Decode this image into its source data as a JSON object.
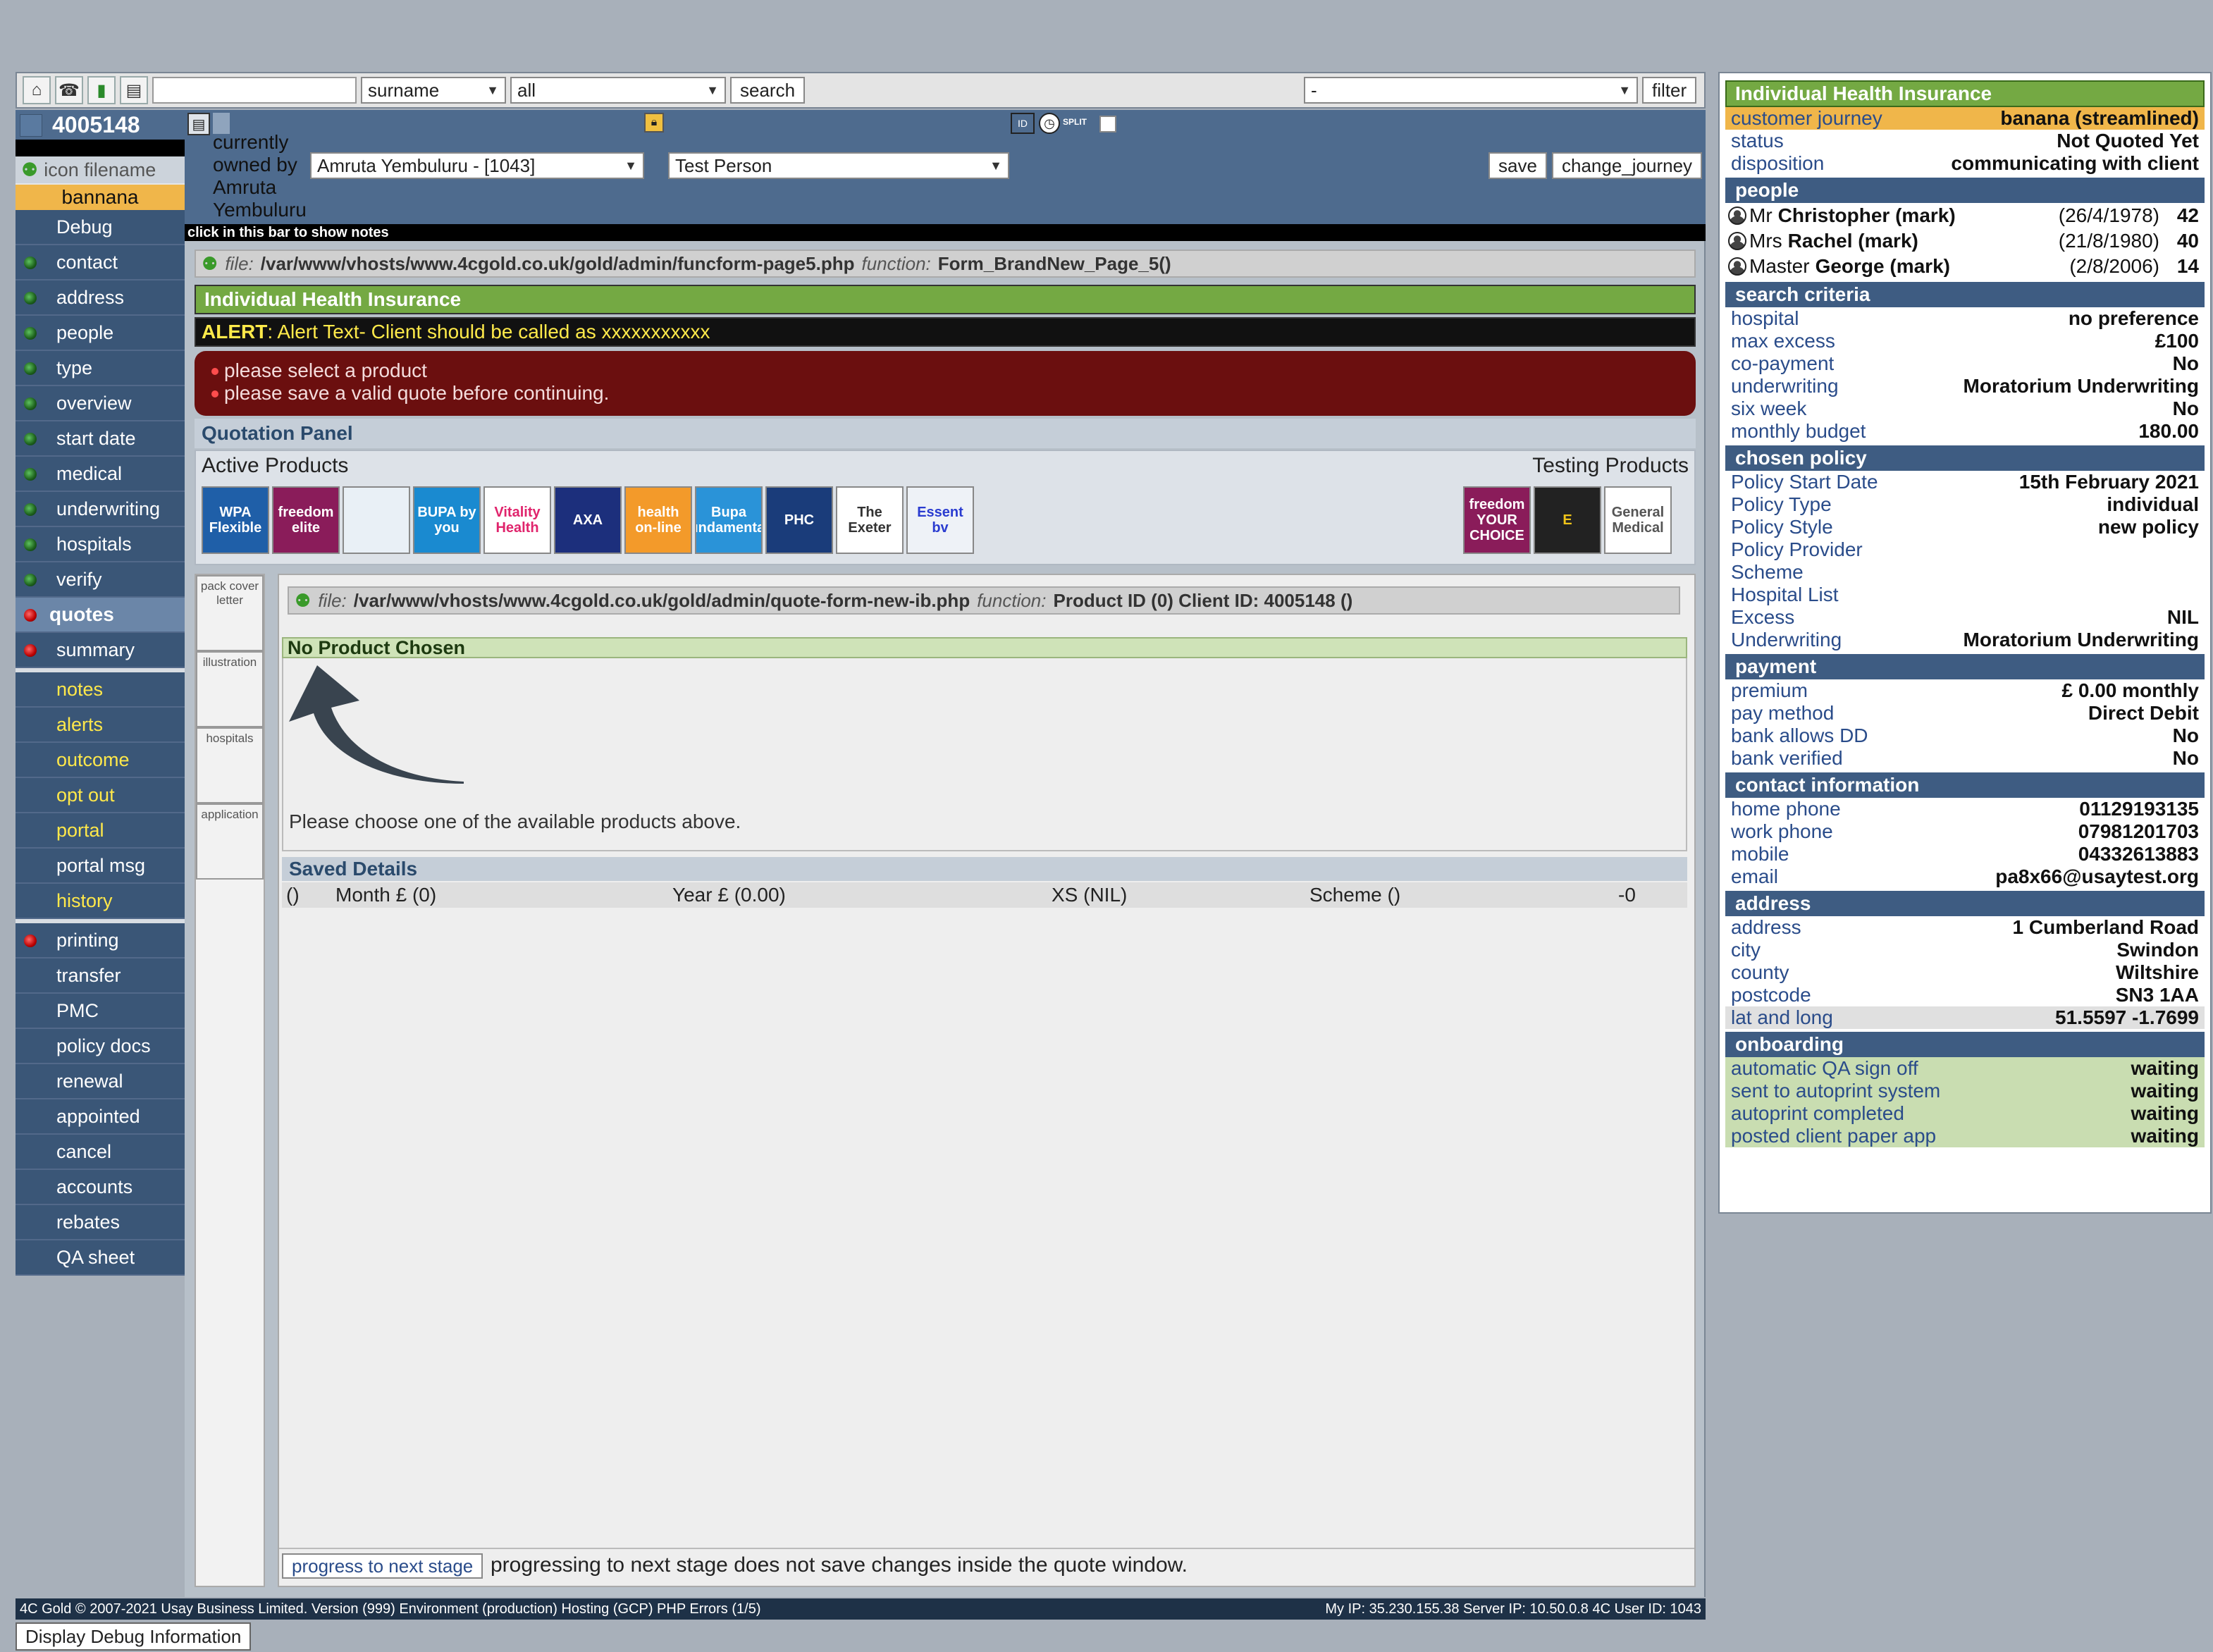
{
  "topbar": {
    "search_value": "",
    "field_select": "surname",
    "scope_select": "all",
    "search_label": "search",
    "filter_select": "-",
    "filter_label": "filter"
  },
  "sidebar": {
    "client_id": "4005148",
    "icon_filename": "icon filename",
    "journey": "bannana",
    "items": [
      {
        "label": "Debug"
      },
      {
        "label": "contact"
      },
      {
        "label": "address"
      },
      {
        "label": "people"
      },
      {
        "label": "type"
      },
      {
        "label": "overview"
      },
      {
        "label": "start date"
      },
      {
        "label": "medical"
      },
      {
        "label": "underwriting"
      },
      {
        "label": "hospitals"
      },
      {
        "label": "verify"
      },
      {
        "label": "quotes"
      },
      {
        "label": "summary"
      },
      {
        "label": "notes"
      },
      {
        "label": "alerts"
      },
      {
        "label": "outcome"
      },
      {
        "label": "opt out"
      },
      {
        "label": "portal"
      },
      {
        "label": "portal msg"
      },
      {
        "label": "history"
      },
      {
        "label": "printing"
      },
      {
        "label": "transfer"
      },
      {
        "label": "PMC"
      },
      {
        "label": "policy docs"
      },
      {
        "label": "renewal"
      },
      {
        "label": "appointed"
      },
      {
        "label": "cancel"
      },
      {
        "label": "accounts"
      },
      {
        "label": "rebates"
      },
      {
        "label": "QA sheet"
      }
    ]
  },
  "header": {
    "owned_by_text": "currently owned by Amruta Yembuluru",
    "owner_select": "Amruta Yembuluru - [1043]",
    "person_select": "Test Person",
    "save_label": "save",
    "change_journey_label": "change_journey",
    "split_label": "SPLIT",
    "id_label": "ID",
    "notes_bar": "click in this bar to show notes"
  },
  "main": {
    "file1": {
      "prefix": "file:",
      "path": "/var/www/vhosts/www.4cgold.co.uk/gold/admin/funcform-page5.php",
      "fn_label": "function:",
      "fn": "Form_BrandNew_Page_5()"
    },
    "product_title": "Individual Health Insurance",
    "alert_label": "ALERT",
    "alert_text": ": Alert Text- Client should be called as xxxxxxxxxxx",
    "errors": [
      "please select a product",
      "please save a valid quote before continuing."
    ],
    "quotation_panel": "Quotation Panel",
    "active_products": "Active Products",
    "testing_products": "Testing Products",
    "active_logos": [
      {
        "name": "wpa-flexible-logo",
        "text": "WPA Flexible",
        "bg": "#1f5fa8",
        "fg": "#ffffff"
      },
      {
        "name": "freedom-elite-logo",
        "text": "freedom elite",
        "bg": "#8a1c5a",
        "fg": "#ffffff"
      },
      {
        "name": "aviva-logo",
        "text": "",
        "bg": "#e9f0f6",
        "fg": "#2a5fa0"
      },
      {
        "name": "bupa-by-you-logo",
        "text": "BUPA by you",
        "bg": "#1a8ad0",
        "fg": "#ffffff"
      },
      {
        "name": "vitality-health-logo",
        "text": "Vitality Health",
        "bg": "#ffffff",
        "fg": "#e0246c"
      },
      {
        "name": "axa-logo",
        "text": "AXA",
        "bg": "#1c2f7c",
        "fg": "#ffffff"
      },
      {
        "name": "health-on-line-logo",
        "text": "health on-line",
        "bg": "#f39a2a",
        "fg": "#ffffff"
      },
      {
        "name": "bupa-fundamentals-logo",
        "text": "Bupa Fundamentals",
        "bg": "#2a93d8",
        "fg": "#ffffff"
      },
      {
        "name": "phc-logo",
        "text": "PHC",
        "bg": "#1a3c7a",
        "fg": "#ffffff"
      },
      {
        "name": "the-exeter-logo",
        "text": "The Exeter",
        "bg": "#ffffff",
        "fg": "#333333"
      },
      {
        "name": "essential-logo",
        "text": "Essent bv",
        "bg": "#eef2f7",
        "fg": "#2a3cd0"
      }
    ],
    "testing_logos": [
      {
        "name": "freedom-your-choice-logo",
        "text": "freedom YOUR CHOICE",
        "bg": "#8a1c5a",
        "fg": "#ffffff"
      },
      {
        "name": "e-logo",
        "text": "E",
        "bg": "#222222",
        "fg": "#f0c419"
      },
      {
        "name": "general-medical-logo",
        "text": "General Medical",
        "bg": "#ffffff",
        "fg": "#555555"
      }
    ],
    "side_tabs": [
      "pack cover letter",
      "illustration",
      "hospitals",
      "application"
    ],
    "file2": {
      "prefix": "file:",
      "path": "/var/www/vhosts/www.4cgold.co.uk/gold/admin/quote-form-new-ib.php",
      "fn_label": "function:",
      "fn": "Product ID (0) Client ID: 4005148 ()"
    },
    "no_product": "No Product Chosen",
    "choose_text": "Please choose one of the available products above.",
    "saved_details": "Saved Details",
    "saved_row": [
      "()",
      "Month £ (0)",
      "Year £ (0.00)",
      "XS (NIL)",
      "Scheme ()",
      "-0"
    ],
    "progress_button": "progress to next stage",
    "progress_note": "progressing to next stage does not save changes inside the quote window."
  },
  "right": {
    "title": "Individual Health Insurance",
    "top_rows": [
      {
        "k": "customer journey",
        "v": "banana (streamlined)"
      },
      {
        "k": "status",
        "v": "Not Quoted Yet"
      },
      {
        "k": "disposition",
        "v": "communicating with client"
      }
    ],
    "people_title": "people",
    "people": [
      {
        "title": "Mr",
        "name": "Christopher (mark)",
        "dob": "(26/4/1978)",
        "age": "42"
      },
      {
        "title": "Mrs",
        "name": "Rachel (mark)",
        "dob": "(21/8/1980)",
        "age": "40"
      },
      {
        "title": "Master",
        "name": "George (mark)",
        "dob": "(2/8/2006)",
        "age": "14"
      }
    ],
    "search_title": "search criteria",
    "search_rows": [
      {
        "k": "hospital",
        "v": "no preference"
      },
      {
        "k": "max excess",
        "v": "£100"
      },
      {
        "k": "co-payment",
        "v": "No"
      },
      {
        "k": "underwriting",
        "v": "Moratorium Underwriting"
      },
      {
        "k": "six week",
        "v": "No"
      },
      {
        "k": "monthly budget",
        "v": "180.00"
      }
    ],
    "policy_title": "chosen policy",
    "policy_rows": [
      {
        "k": "Policy Start Date",
        "v": "15th February 2021"
      },
      {
        "k": "Policy Type",
        "v": "individual"
      },
      {
        "k": "Policy Style",
        "v": "new policy"
      },
      {
        "k": "Policy Provider",
        "v": ""
      },
      {
        "k": "Scheme",
        "v": ""
      },
      {
        "k": "Hospital List",
        "v": ""
      },
      {
        "k": "Excess",
        "v": "NIL"
      },
      {
        "k": "Underwriting",
        "v": "Moratorium Underwriting"
      }
    ],
    "payment_title": "payment",
    "payment_rows": [
      {
        "k": "premium",
        "v": "£ 0.00 monthly"
      },
      {
        "k": "pay method",
        "v": "Direct Debit"
      },
      {
        "k": "bank allows DD",
        "v": "No"
      },
      {
        "k": "bank verified",
        "v": "No"
      }
    ],
    "contact_title": "contact information",
    "contact_rows": [
      {
        "k": "home phone",
        "v": "01129193135"
      },
      {
        "k": "work phone",
        "v": "07981201703"
      },
      {
        "k": "mobile",
        "v": "04332613883"
      },
      {
        "k": "email",
        "v": "pa8x66@usaytest.org"
      }
    ],
    "address_title": "address",
    "address_rows": [
      {
        "k": "address",
        "v": "1 Cumberland Road"
      },
      {
        "k": "city",
        "v": "Swindon"
      },
      {
        "k": "county",
        "v": "Wiltshire"
      },
      {
        "k": "postcode",
        "v": "SN3 1AA"
      },
      {
        "k": "lat and long",
        "v": "51.5597 -1.7699"
      }
    ],
    "onboarding_title": "onboarding",
    "onboarding_rows": [
      {
        "k": "automatic QA sign off",
        "v": "waiting"
      },
      {
        "k": "sent to autoprint system",
        "v": "waiting"
      },
      {
        "k": "autoprint completed",
        "v": "waiting"
      },
      {
        "k": "posted client paper app",
        "v": "waiting"
      }
    ]
  },
  "footer": {
    "left": "4C Gold © 2007-2021 Usay Business Limited. Version (999) Environment (production) Hosting (GCP) PHP Errors (1/5)",
    "right": "My IP: 35.230.155.38 Server IP: 10.50.0.8 4C User ID: 1043",
    "debug_button": "Display Debug Information"
  }
}
